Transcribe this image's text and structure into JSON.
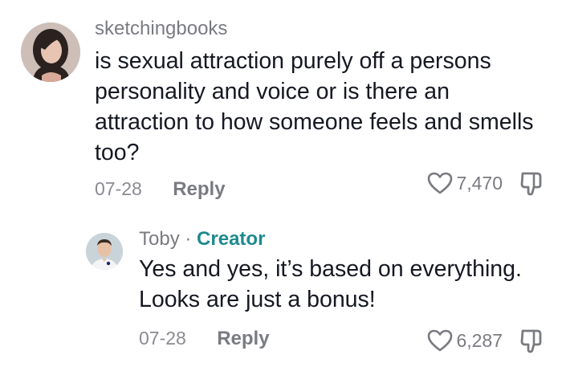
{
  "comments": [
    {
      "username": "sketchingbooks",
      "text": "is sexual attraction purely off a persons personality and voice or is there an attraction to how someone feels and smells too?",
      "date": "07-28",
      "reply_label": "Reply",
      "likes": "7,470",
      "avatar_icon": "user-avatar-photo"
    },
    {
      "username": "Toby",
      "separator": "·",
      "badge": "Creator",
      "text": "Yes and yes, it’s based on everything. Looks are just a bonus!",
      "date": "07-28",
      "reply_label": "Reply",
      "likes": "6,287",
      "avatar_icon": "user-avatar-photo"
    }
  ],
  "icons": {
    "like": "heart-icon",
    "dislike": "thumbs-down-icon"
  },
  "colors": {
    "text": "#161823",
    "muted": "#7a7b81",
    "creator_badge": "#1f8a8f"
  }
}
